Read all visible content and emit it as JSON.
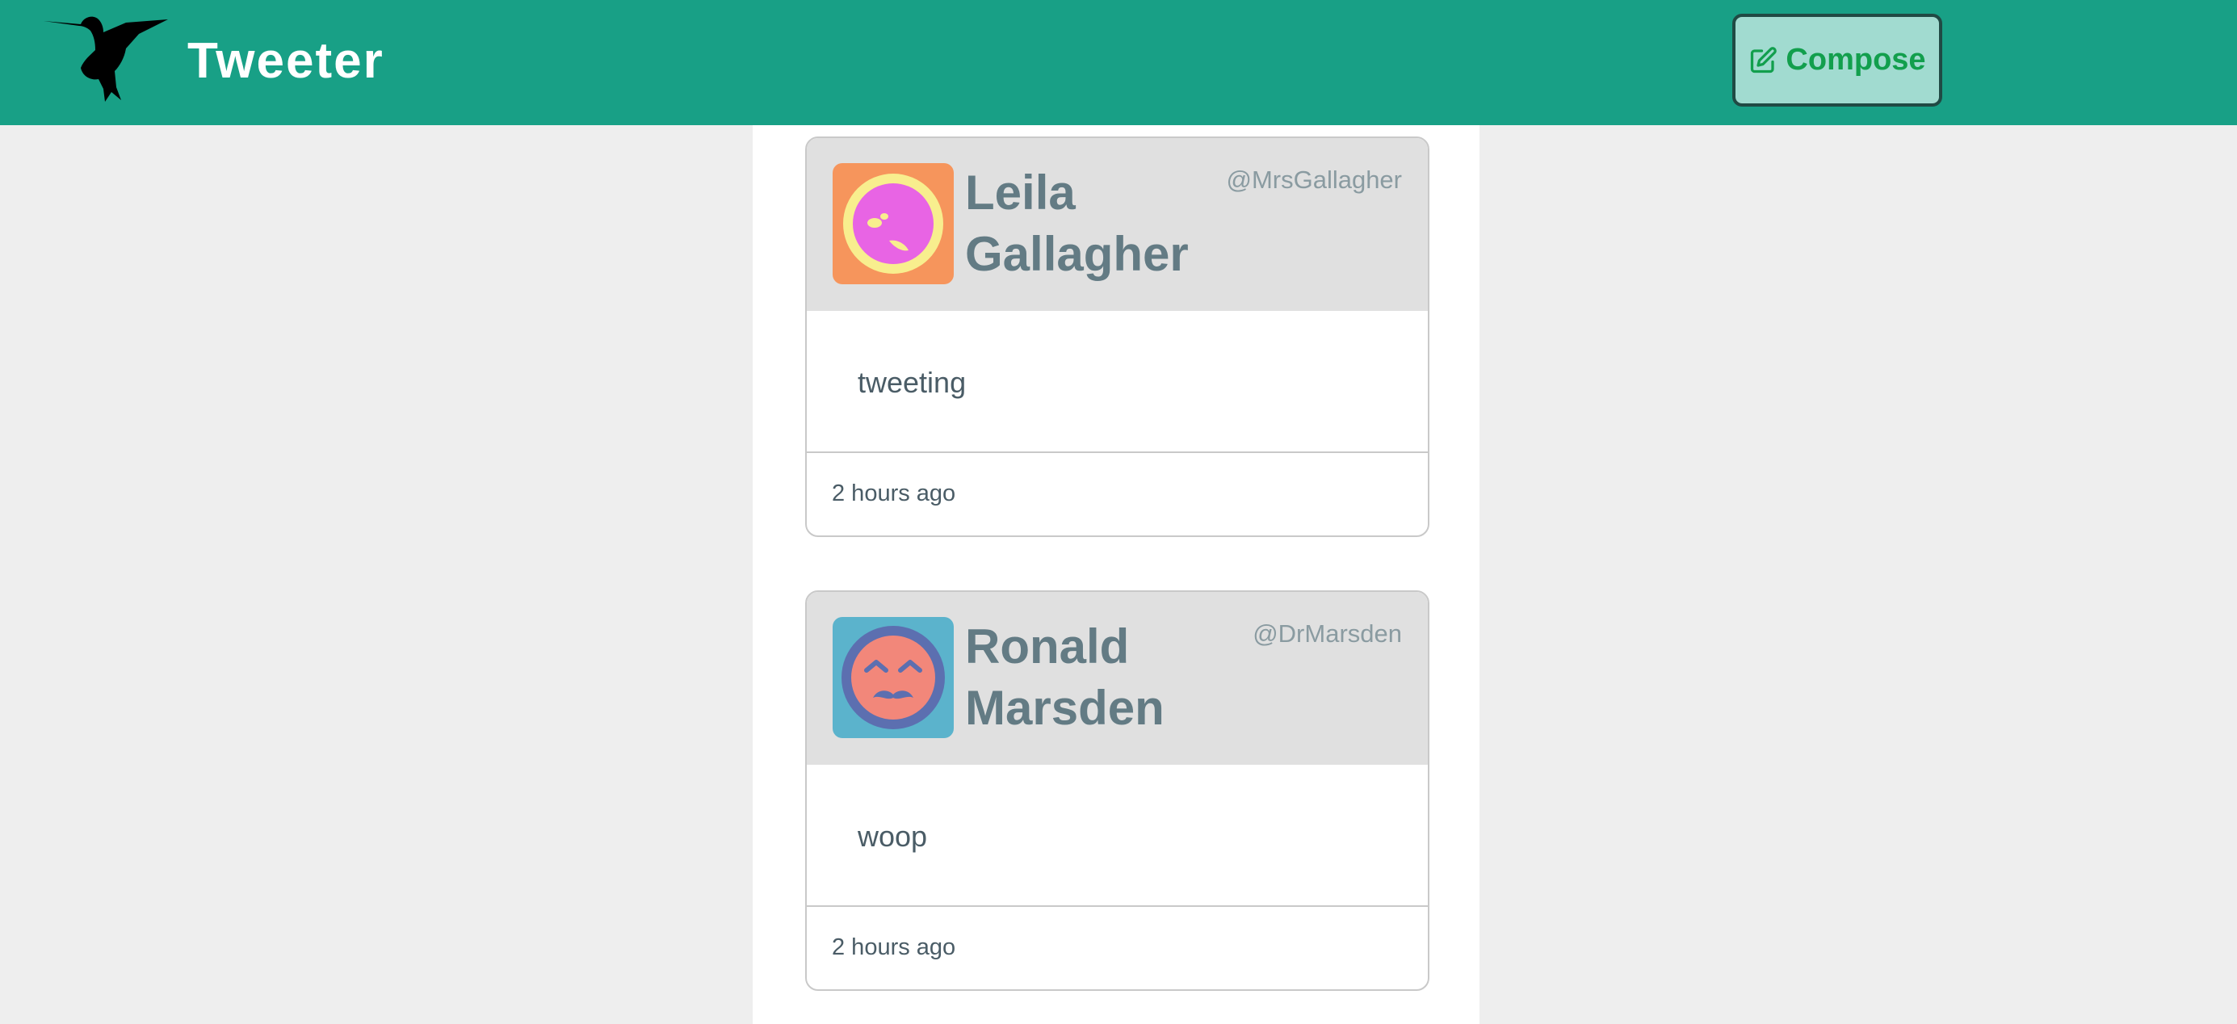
{
  "navbar": {
    "brand": "Tweeter",
    "logo_icon": "hummingbird-icon",
    "background": "#18a086",
    "compose": {
      "label": "Compose",
      "icon": "edit-icon",
      "background": "#a1dbd0",
      "text_color": "#129f4d"
    }
  },
  "tweets": [
    {
      "name": "Leila Gallagher",
      "name_line1": "Leila",
      "name_line2": "Gallagher",
      "handle": "@MrsGallagher",
      "text": "tweeting",
      "time": "2 hours ago",
      "avatar_icon": "avatar-icon",
      "avatar_bg": "#f6955c"
    },
    {
      "name": "Ronald Marsden",
      "name_line1": "Ronald",
      "name_line2": "Marsden",
      "handle": "@DrMarsden",
      "text": "woop",
      "time": "2 hours ago",
      "avatar_icon": "avatar-icon",
      "avatar_bg": "#5bb3cc"
    }
  ]
}
